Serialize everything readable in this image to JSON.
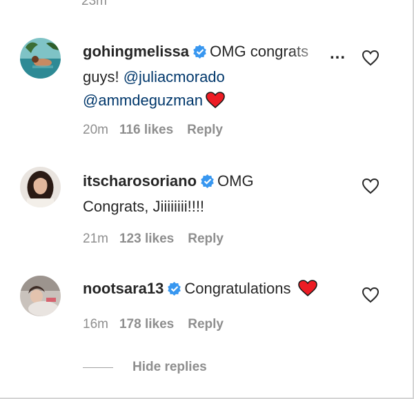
{
  "top_partial_time": "23m",
  "comments": [
    {
      "username": "gohingmelissa",
      "verified": true,
      "text_start": "OMG congrats",
      "text_line2": "guys!",
      "mentions": [
        "@juliacmorado",
        "@ammdeguzman"
      ],
      "emoji": "heart-emoji",
      "time": "20m",
      "likes": "116 likes",
      "reply_label": "Reply",
      "more_label": "..."
    },
    {
      "username": "itscharosoriano",
      "verified": true,
      "text_start": "OMG",
      "text_line2": "Congrats, Jiiiiiiii!!!!",
      "time": "21m",
      "likes": "123 likes",
      "reply_label": "Reply"
    },
    {
      "username": "nootsara13",
      "verified": true,
      "text_start": "Congratulations",
      "emoji": "heart-emoji",
      "time": "16m",
      "likes": "178 likes",
      "reply_label": "Reply"
    }
  ],
  "hide_replies_label": "Hide replies",
  "colors": {
    "verified_blue": "#3897f0",
    "mention_blue": "#00376b",
    "heart_red": "#ed1c24",
    "meta_gray": "#8e8e8e"
  }
}
